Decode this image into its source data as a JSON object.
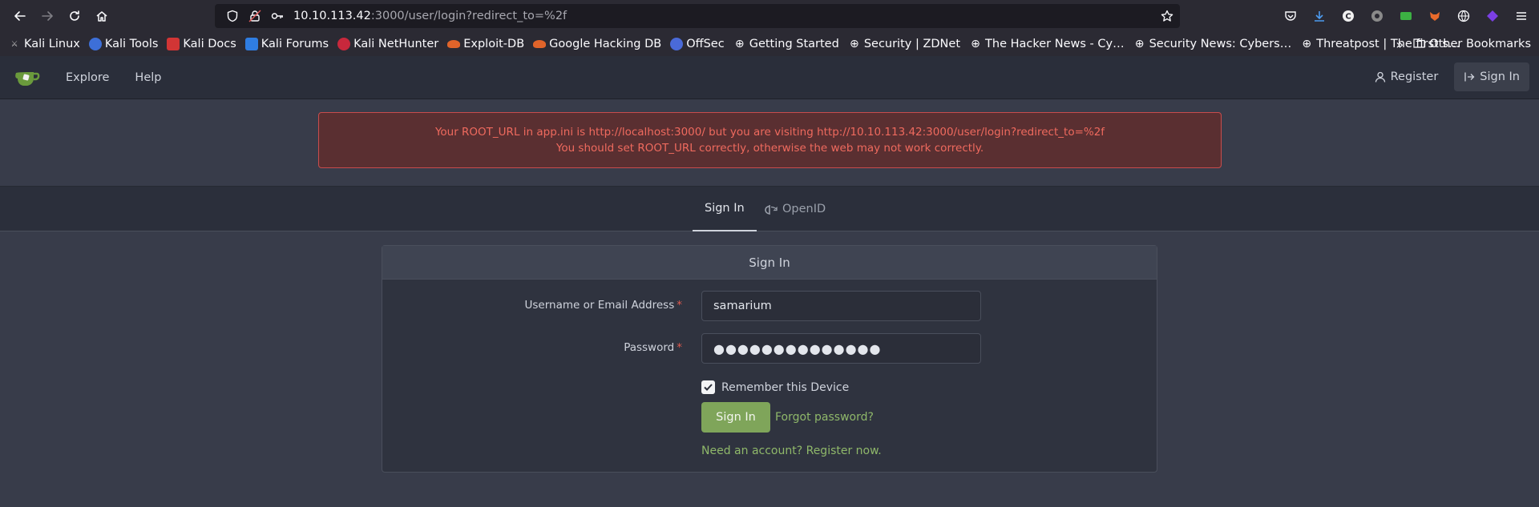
{
  "browser": {
    "url_host": "10.10.113.42",
    "url_rest": ":3000/user/login?redirect_to=%2f",
    "bookmarks": [
      {
        "label": "Kali Linux",
        "icon": "kali-dragon-icon"
      },
      {
        "label": "Kali Tools",
        "icon": "kali-tools-icon"
      },
      {
        "label": "Kali Docs",
        "icon": "kali-docs-icon"
      },
      {
        "label": "Kali Forums",
        "icon": "kali-forums-icon"
      },
      {
        "label": "Kali NetHunter",
        "icon": "nethunter-icon"
      },
      {
        "label": "Exploit-DB",
        "icon": "exploit-db-icon"
      },
      {
        "label": "Google Hacking DB",
        "icon": "ghdb-icon"
      },
      {
        "label": "OffSec",
        "icon": "offsec-icon"
      },
      {
        "label": "Getting Started",
        "icon": "globe-icon"
      },
      {
        "label": "Security | ZDNet",
        "icon": "globe-icon"
      },
      {
        "label": "The Hacker News - Cy…",
        "icon": "globe-icon"
      },
      {
        "label": "Security News: Cybers…",
        "icon": "globe-icon"
      },
      {
        "label": "Threatpost | The first s…",
        "icon": "globe-icon"
      }
    ],
    "other_bookmarks": "Other Bookmarks"
  },
  "header": {
    "explore": "Explore",
    "help": "Help",
    "register": "Register",
    "sign_in": "Sign In"
  },
  "flash": {
    "line1": "Your ROOT_URL in app.ini is http://localhost:3000/ but you are visiting http://10.10.113.42:3000/user/login?redirect_to=%2f",
    "line2": "You should set ROOT_URL correctly, otherwise the web may not work correctly."
  },
  "tabs": {
    "signin": "Sign In",
    "openid": "OpenID"
  },
  "form": {
    "title": "Sign In",
    "username_label": "Username or Email Address",
    "username_value": "samarium",
    "password_label": "Password",
    "password_value": "●●●●●●●●●●●●●●",
    "remember_label": "Remember this Device",
    "remember_checked": true,
    "submit": "Sign In",
    "forgot": "Forgot password?",
    "register": "Need an account? Register now."
  },
  "colors": {
    "accent_green": "#7fa55a",
    "error_red": "#ef6a5e"
  }
}
